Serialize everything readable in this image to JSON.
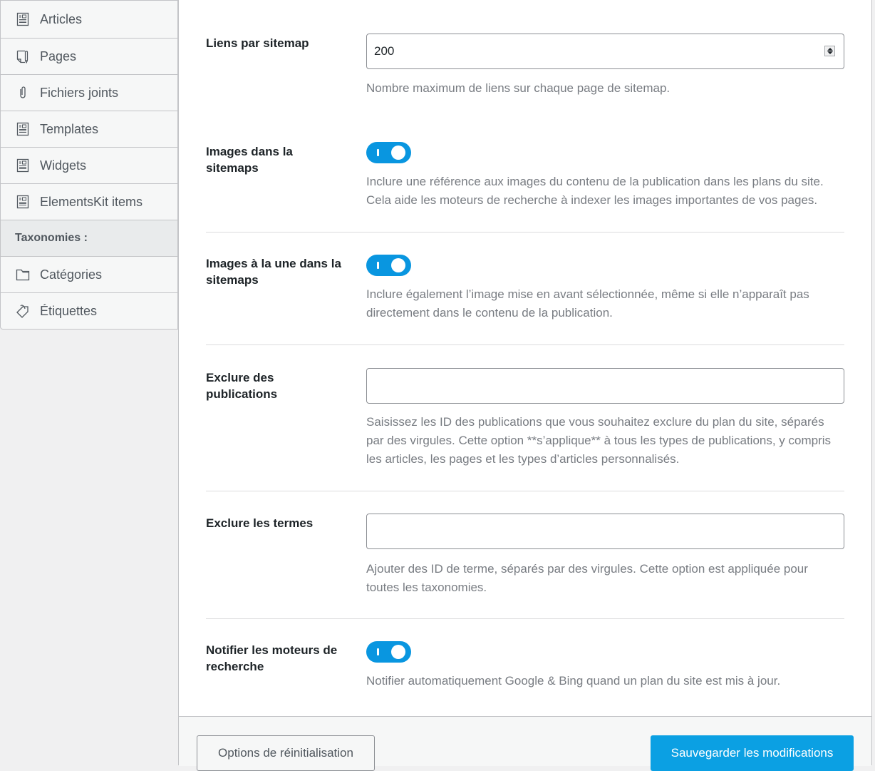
{
  "sidebar": {
    "items": [
      {
        "label": "Articles",
        "icon": "document-icon"
      },
      {
        "label": "Pages",
        "icon": "page-icon"
      },
      {
        "label": "Fichiers joints",
        "icon": "paperclip-icon"
      },
      {
        "label": "Templates",
        "icon": "document-icon"
      },
      {
        "label": "Widgets",
        "icon": "document-icon"
      },
      {
        "label": "ElementsKit items",
        "icon": "document-icon"
      }
    ],
    "taxonomies_header": "Taxonomies :",
    "taxonomies": [
      {
        "label": "Catégories",
        "icon": "folder-icon"
      },
      {
        "label": "Étiquettes",
        "icon": "tag-icon"
      }
    ]
  },
  "settings": {
    "links_per_sitemap": {
      "label": "Liens par sitemap",
      "value": "200",
      "description": "Nombre maximum de liens sur chaque page de sitemap."
    },
    "images_in_sitemap": {
      "label": "Images dans la sitemaps",
      "enabled": true,
      "description_line1": "Inclure une référence aux images du contenu de la publication dans les plans du site.",
      "description_line2": "Cela aide les moteurs de recherche à indexer les images importantes de vos pages."
    },
    "featured_images": {
      "label": "Images à la une dans la sitemaps",
      "enabled": true,
      "description": "Inclure également l’image mise en avant sélectionnée, même si elle n’apparaît pas directement dans le contenu de la publication."
    },
    "exclude_posts": {
      "label": "Exclure des publications",
      "value": "",
      "description": "Saisissez les ID des publications que vous souhaitez exclure du plan du site, séparés par des virgules. Cette option **s’applique** à tous les types de publications, y compris les articles, les pages et les types d’articles personnalisés."
    },
    "exclude_terms": {
      "label": "Exclure les termes",
      "value": "",
      "description": "Ajouter des ID de terme, séparés par des virgules. Cette option est appliquée pour toutes les taxonomies."
    },
    "ping_search_engines": {
      "label": "Notifier les moteurs de recherche",
      "enabled": true,
      "description": "Notifier automatiquement Google & Bing quand un plan du site est mis à jour."
    }
  },
  "footer": {
    "reset_label": "Options de réinitialisation",
    "save_label": "Sauvegarder les modifications"
  },
  "colors": {
    "accent": "#0996e0",
    "save_button": "#0ba0e3"
  }
}
